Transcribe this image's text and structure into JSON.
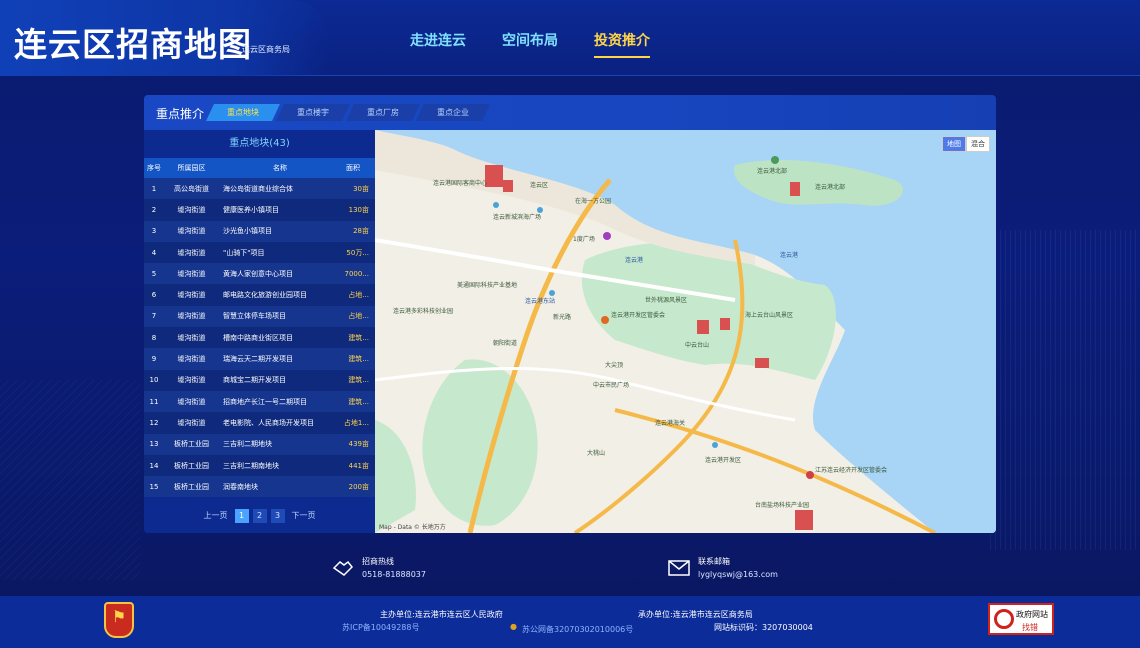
{
  "header": {
    "title": "连云区招商地图",
    "subtitle": "连云区商务局",
    "nav": [
      "走进连云",
      "空间布局",
      "投资推介"
    ],
    "active_nav": 2
  },
  "panel": {
    "title": "重点推介",
    "tabs": [
      "重点地块",
      "重点楼宇",
      "重点厂房",
      "重点企业"
    ],
    "list_title": "重点地块(43)",
    "columns": [
      "序号",
      "所属园区",
      "名称",
      "面积"
    ],
    "rows": [
      [
        "1",
        "高公岛街道",
        "海公岛街道商业综合体",
        "30亩"
      ],
      [
        "2",
        "墟沟街道",
        "健康医养小镇项目",
        "130亩"
      ],
      [
        "3",
        "墟沟街道",
        "沙光鱼小镇项目",
        "28亩"
      ],
      [
        "4",
        "墟沟街道",
        "\"山骑下\"项目",
        "50万..."
      ],
      [
        "5",
        "墟沟街道",
        "黄海人家创意中心项目",
        "7000..."
      ],
      [
        "6",
        "墟沟街道",
        "邮电路文化旅游创业园项目",
        "占地..."
      ],
      [
        "7",
        "墟沟街道",
        "智慧立体停车场项目",
        "占地..."
      ],
      [
        "8",
        "墟沟街道",
        "槽南中路商业街区项目",
        "建筑..."
      ],
      [
        "9",
        "墟沟街道",
        "瑞海云天二期开发项目",
        "建筑..."
      ],
      [
        "10",
        "墟沟街道",
        "商城宝二期开发项目",
        "建筑..."
      ],
      [
        "11",
        "墟沟街道",
        "招商地产长江一号二期项目",
        "建筑..."
      ],
      [
        "12",
        "墟沟街道",
        "老电影院、人民商场开发项目",
        "占地1..."
      ],
      [
        "13",
        "板桥工业园",
        "三吉利二期地块",
        "439亩"
      ],
      [
        "14",
        "板桥工业园",
        "三吉利二期南地块",
        "441亩"
      ],
      [
        "15",
        "板桥工业园",
        "润春南地块",
        "200亩"
      ]
    ],
    "pager": {
      "prev": "上一页",
      "pages": [
        "1",
        "2",
        "3"
      ],
      "next": "下一页",
      "current": "1"
    }
  },
  "map": {
    "toggle": [
      "地图",
      "混合"
    ],
    "credit": "Map - Data © 长地万方",
    "labels": [
      "连云港国际客商中心",
      "连云区",
      "在海一方公园",
      "连云新城滨海广场",
      "1度广场",
      "连云港北部",
      "连云港北部",
      "连云港",
      "连云港东站",
      "连云港开发区管委会",
      "连云港",
      "美通国际科技产业基地",
      "连云港多彩科技创业园",
      "新光路",
      "朝阳街道",
      "世外桃源风景区",
      "海上云台山风景区",
      "大尖顶",
      "中云台山",
      "连云港海关",
      "中云市民广场",
      "大桃山",
      "连云港开发区",
      "江苏连云经济开发区管委会",
      "台南盐场科技产业园"
    ]
  },
  "contact": {
    "hotline_label": "招商热线",
    "hotline": "0518-81888037",
    "email_label": "联系邮箱",
    "email": "lyglyqswj@163.com"
  },
  "footer": {
    "host": "主办单位:连云港市连云区人民政府",
    "organizer": "承办单位:连云港市连云区商务局",
    "icp": "苏ICP备10049288号",
    "police": "苏公网备32070302010006号",
    "site_id": "网站标识码：3207030004",
    "party_emblem": "党政机关",
    "gov_badge_a": "政府网站",
    "gov_badge_b": "找错"
  },
  "colors": {
    "accent": "#ffd54a",
    "nav": "#7fe0ff",
    "panel": "#0d2a8e",
    "tab_active": "#2b8ff0"
  }
}
